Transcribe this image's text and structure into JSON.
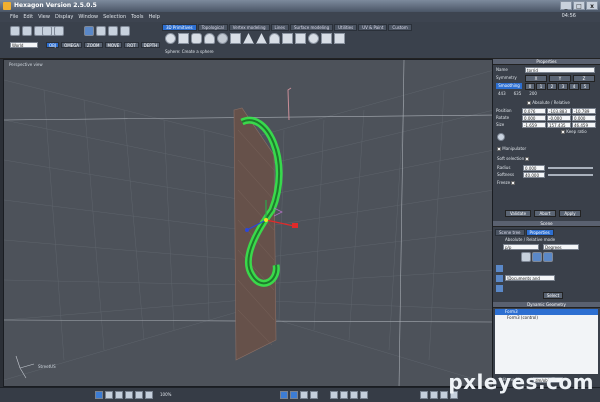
{
  "window": {
    "title": "Hexagon Version 2.5.0.5",
    "minimize": "_",
    "maximize": "□",
    "close": "x"
  },
  "menu": {
    "items": [
      "File",
      "Edit",
      "View",
      "Display",
      "Window",
      "Selection",
      "Tools",
      "Help"
    ],
    "time": "04:56"
  },
  "toolbar": {
    "view_select": "World",
    "mode_buttons": [
      "OBJ",
      "OMEGA"
    ],
    "snap_buttons": [
      "ZOOM",
      "MOVE",
      "ROT",
      "DEPTH"
    ],
    "tabs": [
      "3D Primitives",
      "Topological",
      "Vertex modeling",
      "Lines",
      "Surface modeling",
      "Utilities",
      "UV & Paint",
      "Custom"
    ],
    "active_tab": "3D Primitives",
    "hint": "Sphere: Create a sphere"
  },
  "viewport": {
    "label": "Perspective view",
    "axis_label": "StreetUS"
  },
  "properties": {
    "title": "Properties",
    "name_label": "Name",
    "name_value": "torrid",
    "symmetry_label": "Symmetry",
    "sym_axes": [
      "X",
      "Y",
      "Z"
    ],
    "smoothing_label": "Smoothing",
    "smooth_levels": [
      "0",
      "1",
      "2",
      "3",
      "4",
      "5"
    ],
    "counts": [
      "443",
      "635",
      "200"
    ],
    "absolute": "Absolute",
    "relative": "Relative",
    "position_label": "Position",
    "position": [
      "0.076",
      "-103.883",
      "-10.789"
    ],
    "rotate_label": "Rotate",
    "rotate": [
      "0.000",
      "-0.000",
      "0.000"
    ],
    "size_label": "Size",
    "size": [
      "-1.659",
      "157.435",
      "46.459"
    ],
    "keep_ratio": "Keep ratio",
    "manipulator": "Manipulator",
    "soft_selection": "Soft selection",
    "radius_label": "Radius",
    "radius": "0.000",
    "softness_label": "Softness",
    "softness": "40.000",
    "freeze": "Freeze",
    "buttons": [
      "Validate",
      "Abort",
      "Apply"
    ]
  },
  "scene": {
    "title": "Scene",
    "tabs": [
      "Scene tree",
      "Properties"
    ],
    "mode": "Absolute / Relative mode",
    "field1": "p/p",
    "field2": "Degrees",
    "path": "\\Documents and",
    "select_button": "Select"
  },
  "dynamic": {
    "title": "Dynamic Geometry",
    "items": [
      "Form3",
      "Form3 (control)"
    ],
    "edit_label": "Edit mode",
    "edit_value": "dm/obj"
  },
  "statusbar": {
    "zoom": "100%"
  },
  "watermark": "pxleyes.com",
  "colors": {
    "accent": "#2d6fd1",
    "selection": "#35e84a",
    "viewport": "#4d525a"
  }
}
